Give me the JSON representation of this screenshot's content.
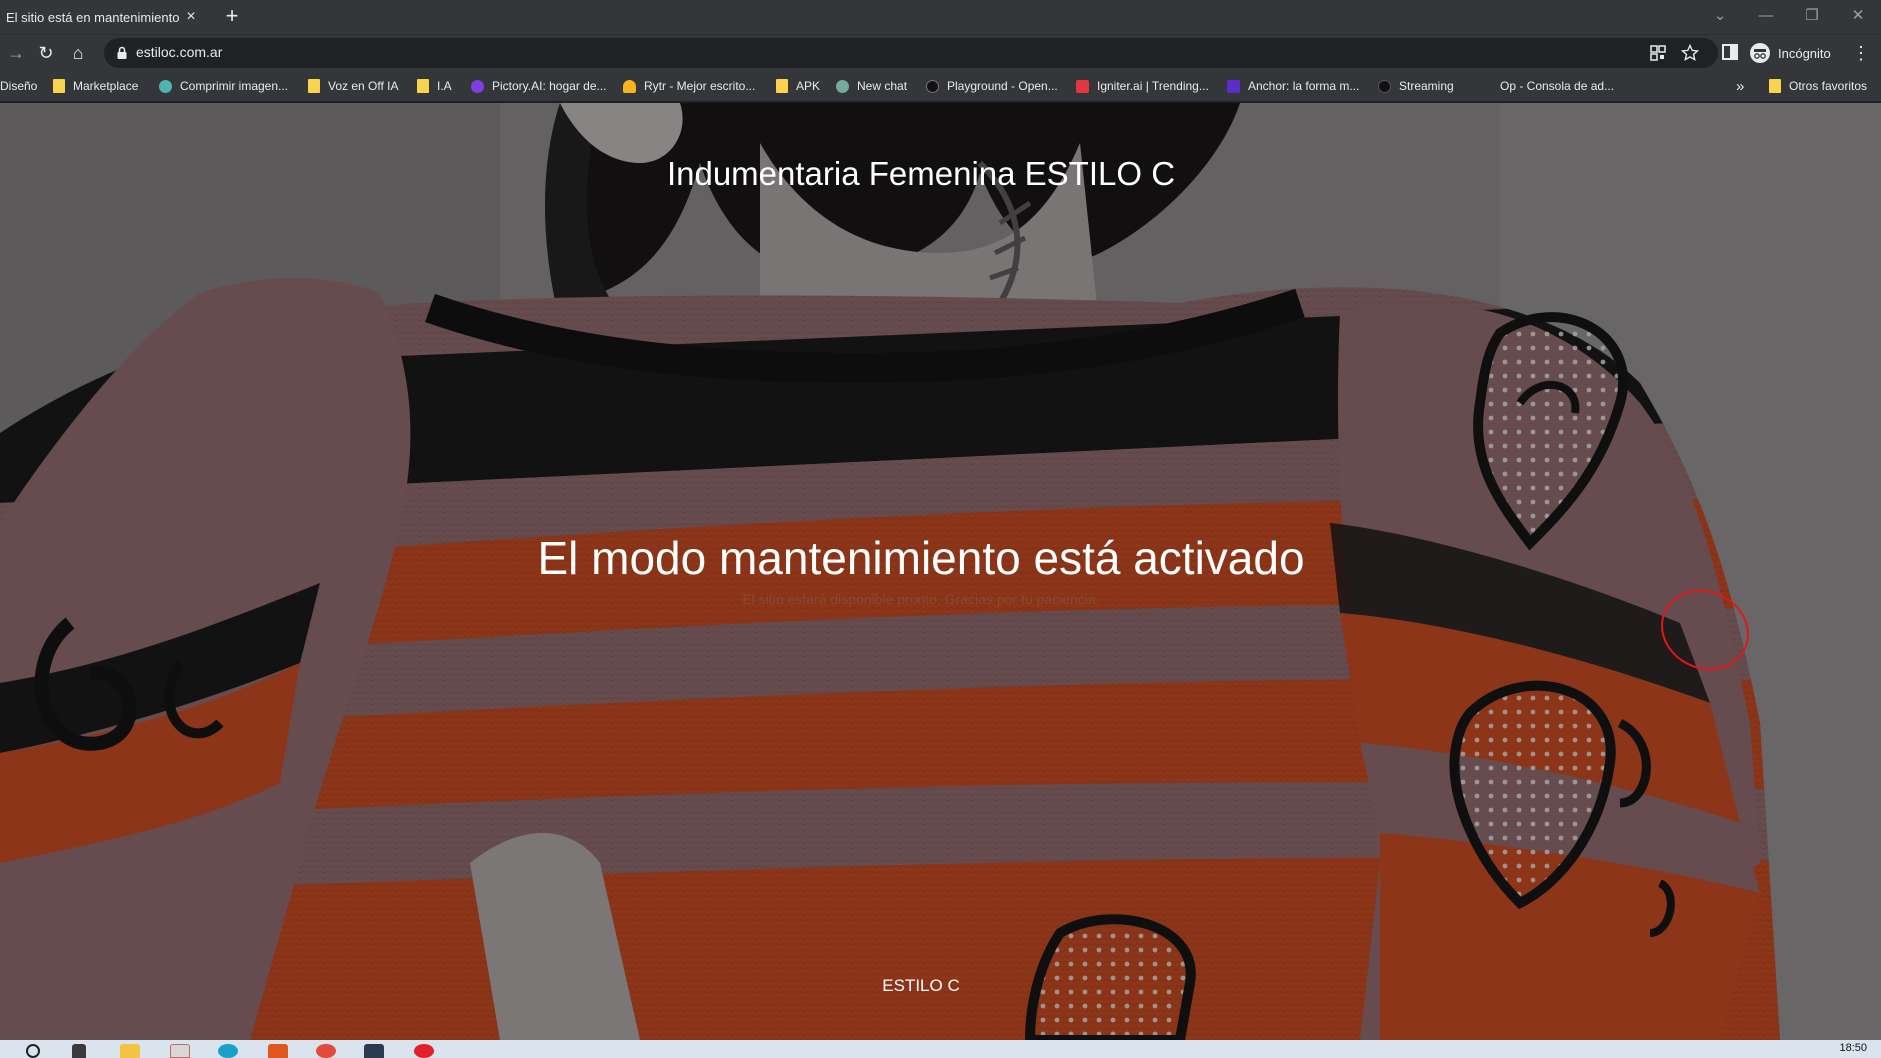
{
  "browser": {
    "tab_title": "El sitio está en mantenimiento",
    "tab_close": "×",
    "new_tab": "+",
    "url": "estiloc.com.ar",
    "profile_label": "Incógnito",
    "window_controls": [
      "⌄",
      "—",
      "❐",
      "✕"
    ],
    "nav": {
      "back": "→",
      "reload": "↻",
      "home": "⌂",
      "menu": "⋮"
    },
    "overflow": "»"
  },
  "bookmarks": [
    {
      "label": "Diseño",
      "icon": "none"
    },
    {
      "label": "Marketplace",
      "icon": "folder"
    },
    {
      "label": "Comprimir imagen...",
      "icon": "compress"
    },
    {
      "label": "Voz en Off IA",
      "icon": "folder"
    },
    {
      "label": "I.A",
      "icon": "folder"
    },
    {
      "label": "Pictory.AI: hogar de...",
      "icon": "pictory"
    },
    {
      "label": "Rytr - Mejor escrito...",
      "icon": "rytr"
    },
    {
      "label": "APK",
      "icon": "folder"
    },
    {
      "label": "New chat",
      "icon": "openai"
    },
    {
      "label": "Playground - Open...",
      "icon": "openai-dark"
    },
    {
      "label": "Igniter.ai | Trending...",
      "icon": "igniter"
    },
    {
      "label": "Anchor: la forma m...",
      "icon": "anchor"
    },
    {
      "label": "Streaming",
      "icon": "streaming"
    },
    {
      "label": "Op - Consola de ad...",
      "icon": "none"
    }
  ],
  "other_bookmarks": "Otros favoritos",
  "site": {
    "title": "Indumentaria Femenina ESTILO C",
    "headline": "El modo mantenimiento está activado",
    "subline": "El sitio estará disponible pronto. Gracias por tu paciencia.",
    "footer": "ESTILO C"
  },
  "taskbar": {
    "time": "18:50"
  },
  "colors": {
    "chrome": "#35363a",
    "omnibox": "#202124",
    "sweater_orange": "#c24a22",
    "sweater_mauve": "#8e6a6c",
    "sweater_black": "#1b1a1a",
    "annotation_red": "#e01818"
  }
}
